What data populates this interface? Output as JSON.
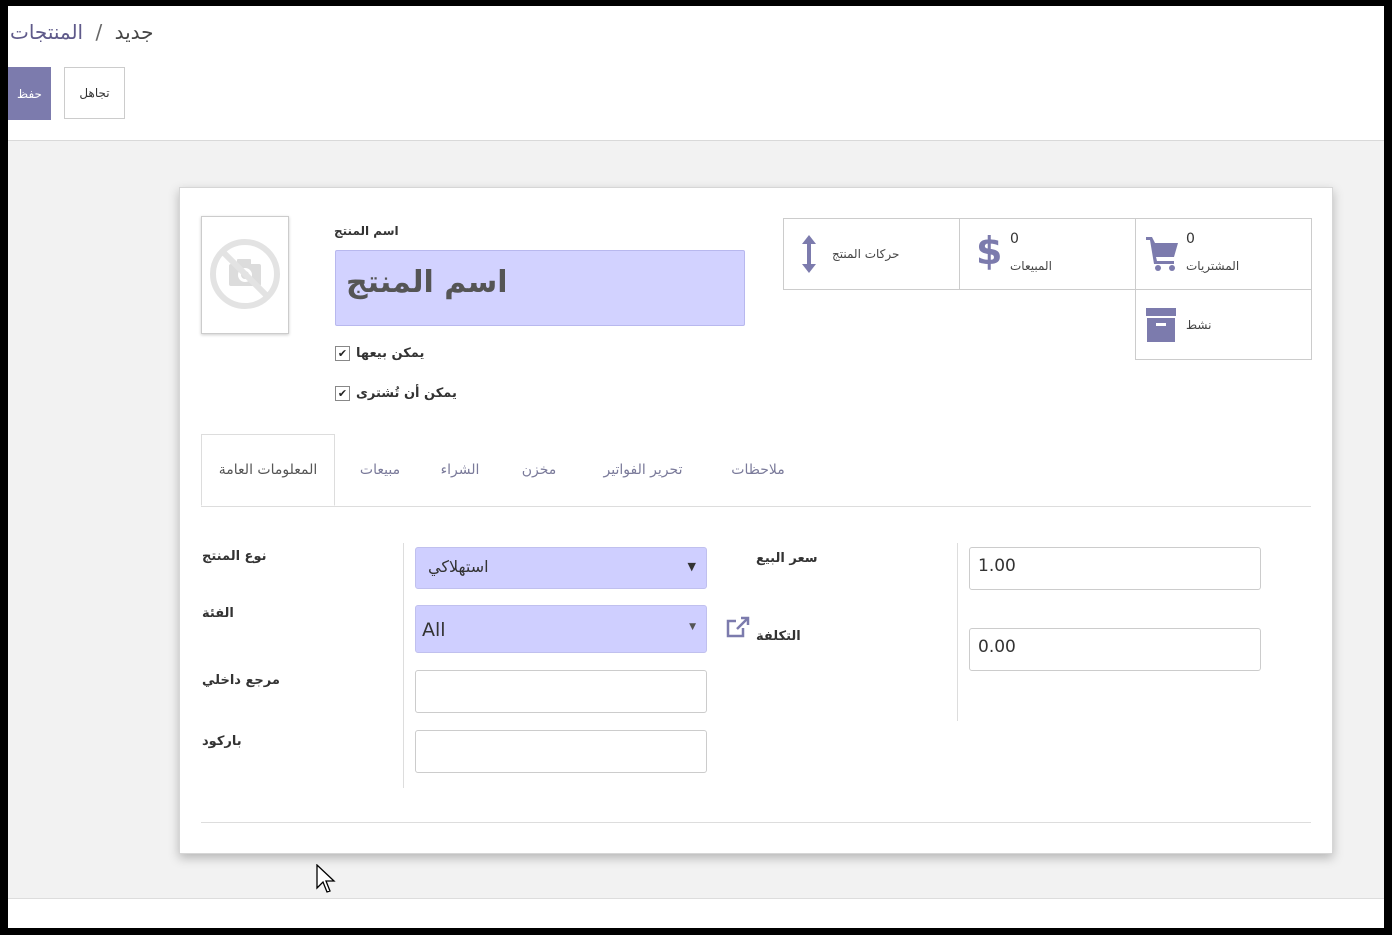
{
  "breadcrumb": {
    "parent": "المنتجات",
    "separator": "/",
    "current": "جديد"
  },
  "buttons": {
    "save": "حفظ",
    "discard": "تجاهل"
  },
  "product": {
    "name_label": "اسم المنتج",
    "name_placeholder": "اسم المنتج",
    "can_be_sold": "يمكن بيعها",
    "can_be_purchased": "يمكن أن تُشترى"
  },
  "smart_buttons": {
    "purchases": {
      "count": "0",
      "label": "المشتريات",
      "icon": "cart-icon"
    },
    "sales": {
      "count": "0",
      "label": "المبيعات",
      "icon": "dollar-icon"
    },
    "moves": {
      "label": "حركات المنتج",
      "icon": "arrows-vertical-icon"
    },
    "active": {
      "label": "نشط",
      "icon": "archive-icon"
    }
  },
  "tabs": [
    "المعلومات العامة",
    "مبيعات",
    "الشراء",
    "مخزن",
    "تحرير الفواتير",
    "ملاحظات"
  ],
  "fields": {
    "product_type": {
      "label": "نوع المنتج",
      "value": "استهلاكي"
    },
    "category": {
      "label": "الفئة",
      "value": "All"
    },
    "internal_ref": {
      "label": "مرجع داخلي",
      "value": ""
    },
    "barcode": {
      "label": "باركود",
      "value": ""
    },
    "sale_price": {
      "label": "سعر البيع",
      "value": "1.00"
    },
    "cost": {
      "label": "التكلفة",
      "value": "0.00"
    }
  },
  "colors": {
    "brand": "#7c7bad",
    "input_highlight": "#d2d2ff"
  }
}
